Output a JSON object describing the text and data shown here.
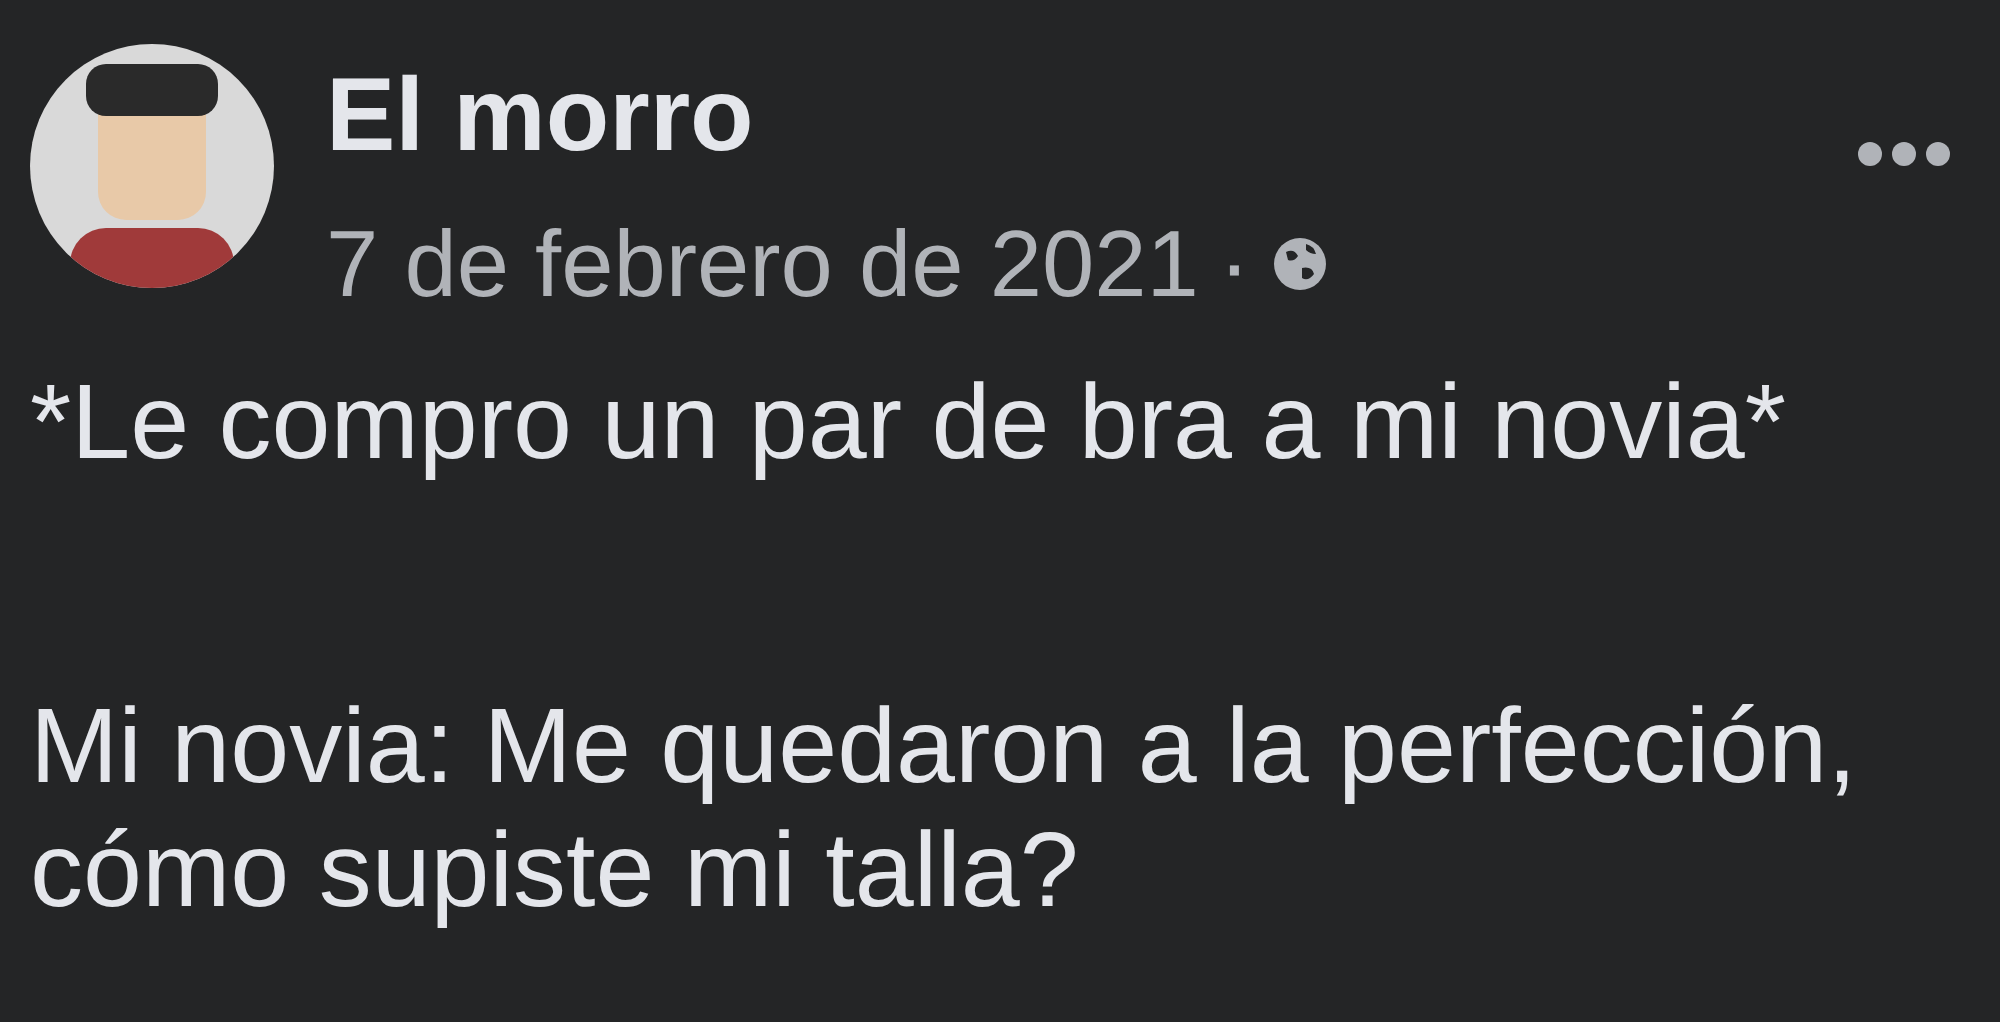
{
  "post": {
    "author": "El morro",
    "date": "7 de febrero de 2021",
    "separator": "·",
    "public": true,
    "paragraphs": [
      "*Le compro un par de bra a mi novia*",
      "Mi novia: Me quedaron a la perfección, cómo supiste mi talla?"
    ]
  }
}
